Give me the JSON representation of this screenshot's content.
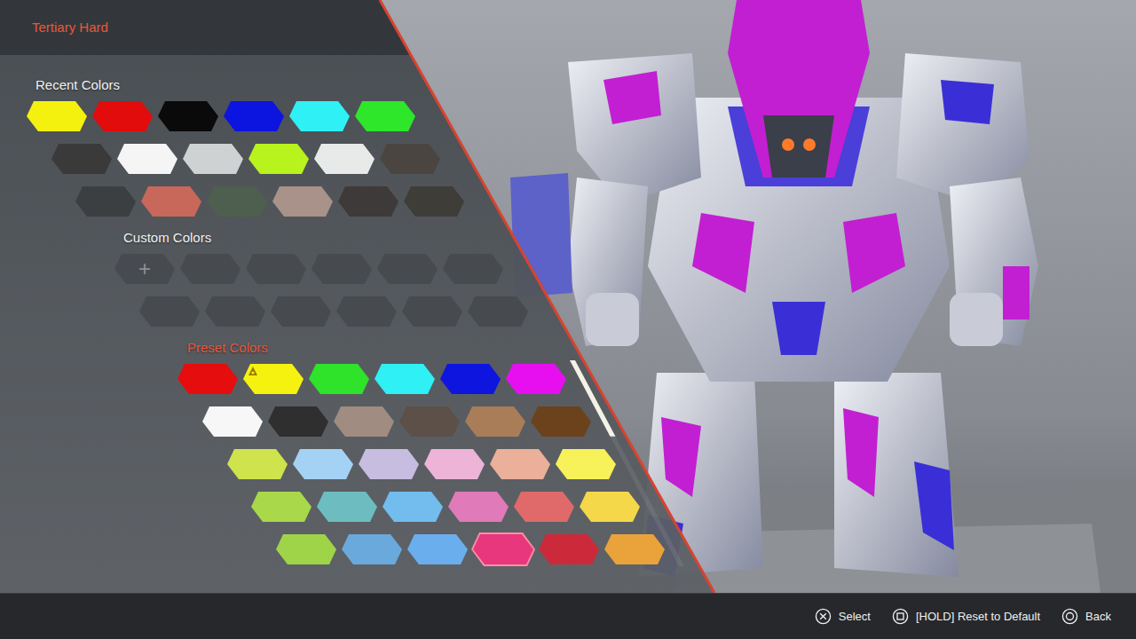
{
  "title": "Tertiary Hard",
  "sections": [
    {
      "label": "Recent Colors",
      "selected": false,
      "kind": "swatches",
      "rows": [
        [
          {
            "color": "#f5f10f",
            "selected": false,
            "current": false
          },
          {
            "color": "#e20c0c",
            "selected": false,
            "current": false
          },
          {
            "color": "#0a0a0a",
            "selected": false,
            "current": false
          },
          {
            "color": "#0c14e0",
            "selected": false,
            "current": false
          },
          {
            "color": "#2ff0f5",
            "selected": false,
            "current": false
          },
          {
            "color": "#2ee62a",
            "selected": false,
            "current": false
          }
        ],
        [
          {
            "color": "#3a3a3a",
            "selected": false,
            "current": false
          },
          {
            "color": "#f5f5f5",
            "selected": false,
            "current": false
          },
          {
            "color": "#cfd2d2",
            "selected": false,
            "current": false
          },
          {
            "color": "#b8f31e",
            "selected": false,
            "current": false
          },
          {
            "color": "#e8eaea",
            "selected": false,
            "current": false
          },
          {
            "color": "#4a4541",
            "selected": false,
            "current": false
          }
        ],
        [
          {
            "color": "#3b3f42",
            "selected": false,
            "current": false
          },
          {
            "color": "#c8685a",
            "selected": false,
            "current": false
          },
          {
            "color": "#4e5f4f",
            "selected": false,
            "current": false
          },
          {
            "color": "#a8928a",
            "selected": false,
            "current": false
          },
          {
            "color": "#3d3a39",
            "selected": false,
            "current": false
          },
          {
            "color": "#3e3d38",
            "selected": false,
            "current": false
          }
        ]
      ]
    },
    {
      "label": "Custom Colors",
      "selected": false,
      "kind": "custom",
      "rows": [
        [
          {
            "kind": "add",
            "label": "+",
            "selected": false
          },
          {
            "kind": "empty",
            "selected": false
          },
          {
            "kind": "empty",
            "selected": false
          },
          {
            "kind": "empty",
            "selected": false
          },
          {
            "kind": "empty",
            "selected": false
          },
          {
            "kind": "empty",
            "selected": false
          }
        ],
        [
          {
            "kind": "empty",
            "selected": false
          },
          {
            "kind": "empty",
            "selected": false
          },
          {
            "kind": "empty",
            "selected": false
          },
          {
            "kind": "empty",
            "selected": false
          },
          {
            "kind": "empty",
            "selected": false
          },
          {
            "kind": "empty",
            "selected": false
          }
        ]
      ]
    },
    {
      "label": "Preset Colors",
      "selected": true,
      "kind": "swatches",
      "scrollbar": {
        "level": 0.37
      },
      "rows": [
        [
          {
            "color": "#e50d0d",
            "selected": false,
            "current": false
          },
          {
            "color": "#f6f20f",
            "selected": false,
            "current": true
          },
          {
            "color": "#2ee32a",
            "selected": false,
            "current": false
          },
          {
            "color": "#2ef0f5",
            "selected": false,
            "current": false
          },
          {
            "color": "#0d15df",
            "selected": false,
            "current": false
          },
          {
            "color": "#e70ff0",
            "selected": false,
            "current": false
          }
        ],
        [
          {
            "color": "#f7f7f7",
            "selected": false,
            "current": false
          },
          {
            "color": "#2f2f2f",
            "selected": false,
            "current": false
          },
          {
            "color": "#a08c80",
            "selected": false,
            "current": false
          },
          {
            "color": "#5c5048",
            "selected": false,
            "current": false
          },
          {
            "color": "#a87d58",
            "selected": false,
            "current": false
          },
          {
            "color": "#6b421b",
            "selected": false,
            "current": false
          }
        ],
        [
          {
            "color": "#cfe34d",
            "selected": false,
            "current": false
          },
          {
            "color": "#a4d2f5",
            "selected": false,
            "current": false
          },
          {
            "color": "#c7bde0",
            "selected": false,
            "current": false
          },
          {
            "color": "#edb4d8",
            "selected": false,
            "current": false
          },
          {
            "color": "#eab09a",
            "selected": false,
            "current": false
          },
          {
            "color": "#f7f15a",
            "selected": false,
            "current": false
          }
        ],
        [
          {
            "color": "#a9d84a",
            "selected": false,
            "current": false
          },
          {
            "color": "#6dbdc0",
            "selected": false,
            "current": false
          },
          {
            "color": "#72bdee",
            "selected": false,
            "current": false
          },
          {
            "color": "#e07ab8",
            "selected": false,
            "current": false
          },
          {
            "color": "#e06a6a",
            "selected": false,
            "current": false
          },
          {
            "color": "#f5d84a",
            "selected": false,
            "current": false
          }
        ],
        [
          {
            "color": "#9fd449",
            "selected": false,
            "current": false
          },
          {
            "color": "#6aa9dc",
            "selected": false,
            "current": false
          },
          {
            "color": "#6aaeee",
            "selected": false,
            "current": false
          },
          {
            "color": "#e8377c",
            "selected": true,
            "current": false
          },
          {
            "color": "#cc2a3a",
            "selected": false,
            "current": false
          },
          {
            "color": "#eaa33a",
            "selected": false,
            "current": false
          }
        ]
      ]
    }
  ],
  "hints": [
    {
      "kind": "cross",
      "label": "Select"
    },
    {
      "kind": "square",
      "label": "[HOLD] Reset to Default"
    },
    {
      "kind": "circle",
      "label": "Back"
    }
  ]
}
